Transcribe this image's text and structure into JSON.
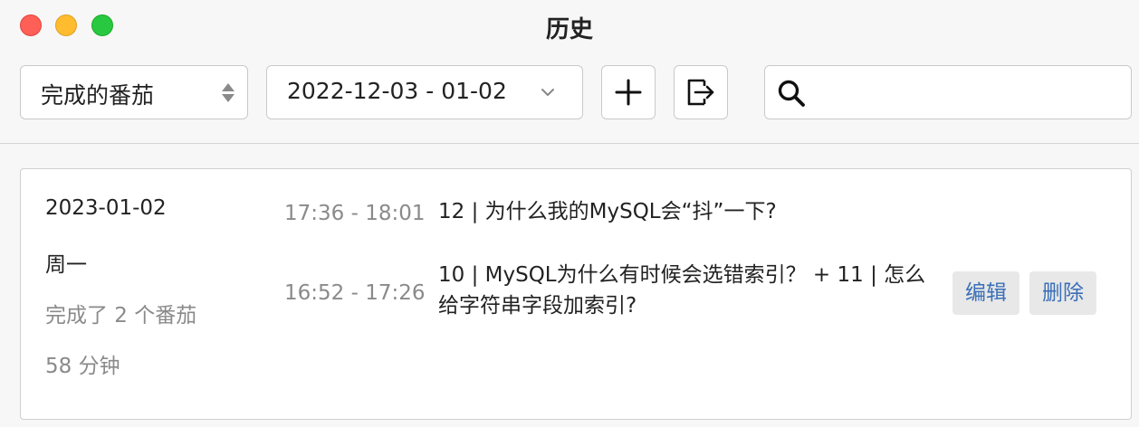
{
  "window": {
    "title": "历史"
  },
  "toolbar": {
    "type_select": {
      "value": "完成的番茄"
    },
    "date_range": {
      "value": "2022-12-03 - 01-02"
    },
    "add_icon": "plus-icon",
    "export_icon": "export-icon",
    "search": {
      "value": "",
      "placeholder": "",
      "icon": "search-icon"
    }
  },
  "days": [
    {
      "date": "2023-01-02",
      "weekday": "周一",
      "count_text": "完成了 2 个番茄",
      "minutes_text": "58 分钟",
      "entries": [
        {
          "time": "17:36 - 18:01",
          "title": "12 | 为什么我的MySQL会“抖”一下?"
        },
        {
          "time": "16:52 - 17:26",
          "title": "10 | MySQL为什么有时候会选错索引？ + 11 | 怎么给字符串字段加索引?"
        }
      ],
      "actions": {
        "edit": "编辑",
        "delete": "删除"
      }
    }
  ],
  "colors": {
    "close": "#fe5f57",
    "minimize": "#febc2e",
    "zoom": "#28c840",
    "action_text": "#3a6fb8"
  }
}
